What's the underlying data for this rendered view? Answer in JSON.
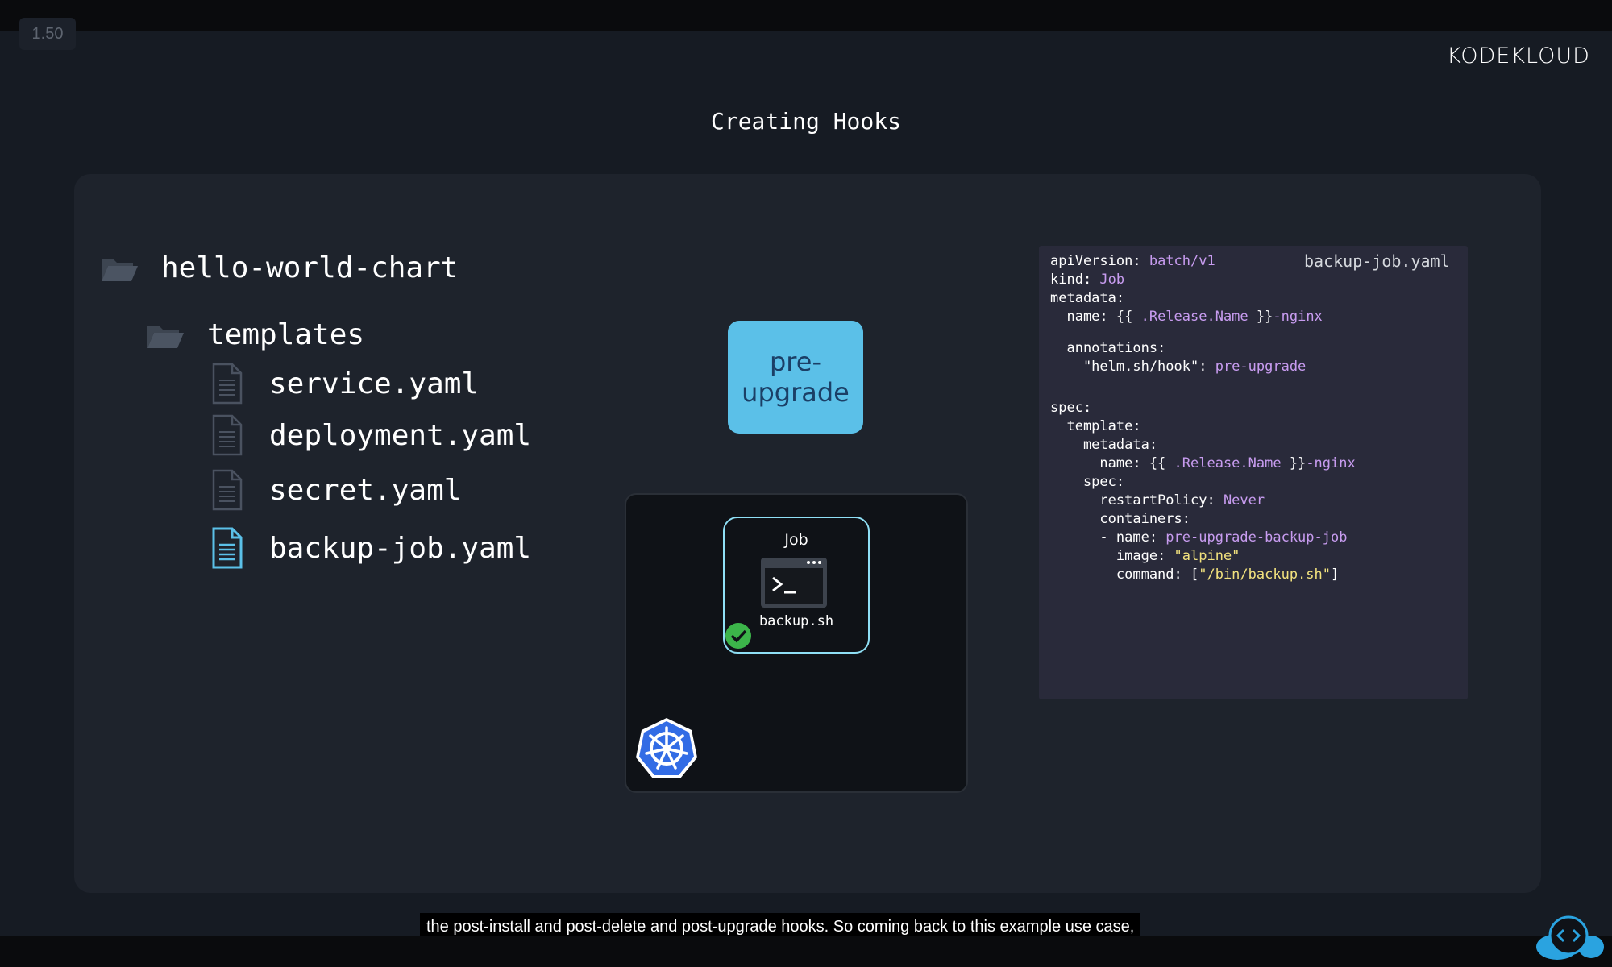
{
  "player": {
    "speed": "1.50"
  },
  "brand": {
    "logo_text": "KODEKLOUD"
  },
  "slide": {
    "title": "Creating Hooks"
  },
  "tree": {
    "root": "hello-world-chart",
    "folder": "templates",
    "files": [
      "service.yaml",
      "deployment.yaml",
      "secret.yaml",
      "backup-job.yaml"
    ],
    "highlighted_file_color": "#5bc0e8",
    "file_icon": "document-icon",
    "folder_icon": "folder-icon"
  },
  "hook": {
    "label": "pre-\nupgrade",
    "color": "#5bc0e8"
  },
  "job": {
    "label": "Job",
    "script": "backup.sh",
    "status_icon": "check-circle-icon",
    "status_color": "#3cb54a"
  },
  "cluster": {
    "icon": "kubernetes-icon",
    "icon_color": "#326ce5"
  },
  "code": {
    "filename": "backup-job.yaml",
    "lines": [
      {
        "k": "apiVersion: ",
        "v": "batch/v1"
      },
      {
        "k": "kind: ",
        "v": "Job"
      },
      {
        "k": "metadata:"
      },
      {
        "k": "  name: {{ ",
        "v": ".Release.Name",
        "k2": " }}",
        "v2": "-nginx"
      },
      {
        "k": "  annotations:"
      },
      {
        "k": "    \"helm.sh/hook\": ",
        "v": "pre-upgrade"
      },
      {
        "k": "spec:"
      },
      {
        "k": "  template:"
      },
      {
        "k": "    metadata:"
      },
      {
        "k": "      name: {{ ",
        "v": ".Release.Name",
        "k2": " }}",
        "v2": "-nginx"
      },
      {
        "k": "    spec:"
      },
      {
        "k": "      restartPolicy: ",
        "v": "Never"
      },
      {
        "k": "      containers:"
      },
      {
        "k": "      - name: ",
        "v": "pre-upgrade-backup-job"
      },
      {
        "k": "        image: ",
        "s": "\"alpine\""
      },
      {
        "k": "        command: [",
        "s": "\"/bin/backup.sh\"",
        "k2": "]"
      }
    ]
  },
  "caption": "the post-install and post-delete and post-upgrade hooks. So coming back to this example use case,"
}
